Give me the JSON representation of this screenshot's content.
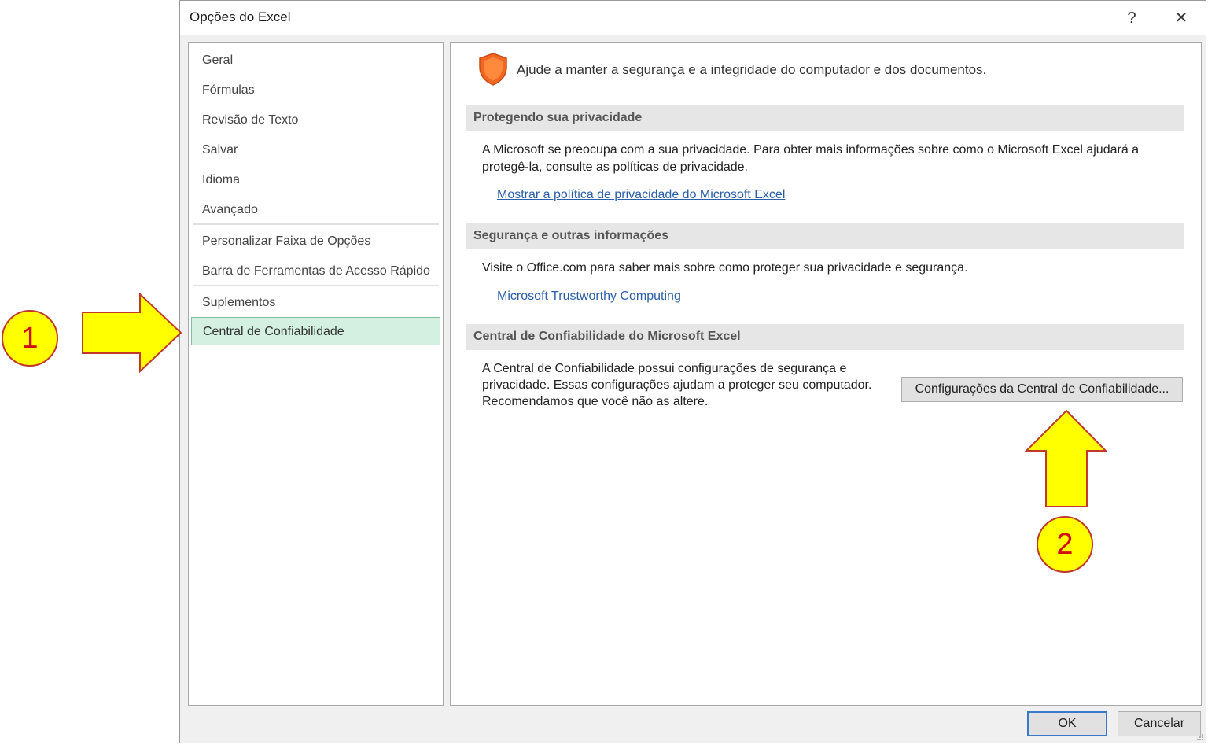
{
  "dialog": {
    "title": "Opções do Excel",
    "help_label": "?",
    "close_label": "✕"
  },
  "nav": {
    "items": [
      {
        "label": "Geral"
      },
      {
        "label": "Fórmulas"
      },
      {
        "label": "Revisão de Texto"
      },
      {
        "label": "Salvar"
      },
      {
        "label": "Idioma"
      },
      {
        "label": "Avançado"
      },
      {
        "label": "Personalizar Faixa de Opções"
      },
      {
        "label": "Barra de Ferramentas de Acesso Rápido"
      },
      {
        "label": "Suplementos"
      },
      {
        "label": "Central de Confiabilidade",
        "selected": true
      }
    ]
  },
  "content": {
    "intro": "Ajude a manter a segurança e a integridade do computador e dos documentos.",
    "sections": [
      {
        "heading": "Protegendo sua privacidade",
        "text_line1": "A Microsoft se preocupa com a sua privacidade. Para obter mais informações sobre como o Microsoft Excel ajudará a",
        "text_line2": "protegê-la, consulte as políticas de privacidade.",
        "link": "Mostrar a política de privacidade do Microsoft Excel"
      },
      {
        "heading": "Segurança e outras informações",
        "text": "Visite o Office.com para saber mais sobre como proteger sua privacidade e segurança.",
        "link": "Microsoft Trustworthy Computing"
      },
      {
        "heading": "Central de Confiabilidade do Microsoft Excel",
        "text_line1": "A Central de Confiabilidade possui configurações de segurança e",
        "text_line2": "privacidade. Essas configurações ajudam a proteger seu computador.",
        "text_line3": "Recomendamos que você não as altere.",
        "button": "Configurações da Central de Confiabilidade..."
      }
    ]
  },
  "footer": {
    "ok_label": "OK",
    "cancel_label": "Cancelar"
  },
  "annotations": {
    "badge1": "1",
    "badge2": "2",
    "arrow_color": "#ffff00",
    "badge_border_color": "#c0392b",
    "badge_text_color": "#d01010"
  },
  "colors": {
    "selected_bg": "#d3f0e0",
    "link": "#2a5ea8",
    "shield": "#f26522"
  }
}
